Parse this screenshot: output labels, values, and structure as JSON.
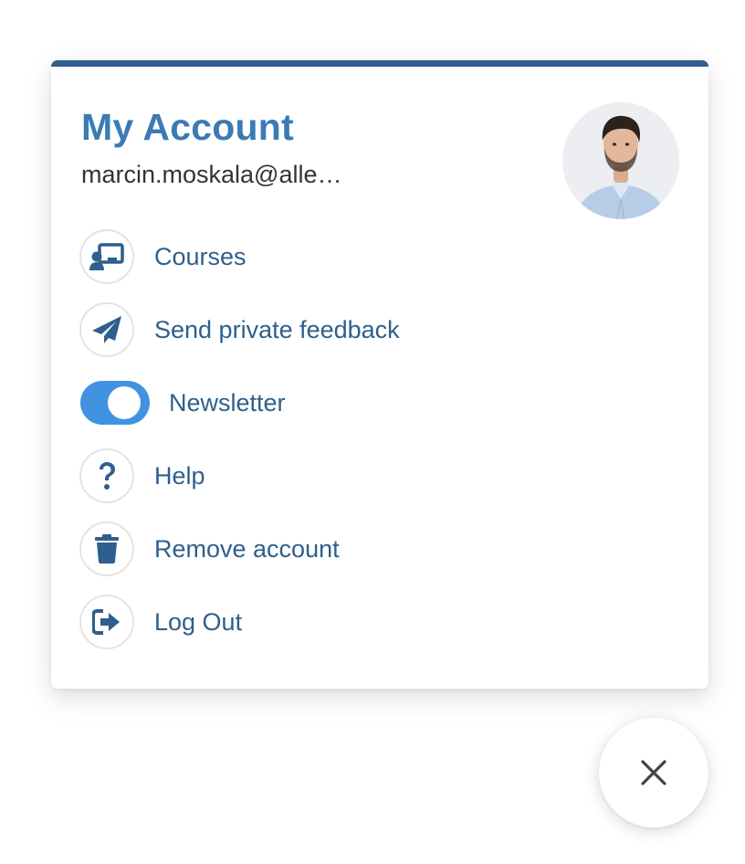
{
  "account_menu": {
    "title": "My Account",
    "email": "marcin.moskala@alle…",
    "accent_color": "#2f5f8c",
    "title_color": "#3b7ab5",
    "items": [
      {
        "label": "Courses",
        "icon": "courses-icon"
      },
      {
        "label": "Send private feedback",
        "icon": "paper-plane-icon"
      },
      {
        "label": "Newsletter",
        "icon": "toggle-switch",
        "toggle_on": true
      },
      {
        "label": "Help",
        "icon": "question-mark-icon"
      },
      {
        "label": "Remove account",
        "icon": "trash-icon"
      },
      {
        "label": "Log Out",
        "icon": "sign-out-icon"
      }
    ]
  },
  "close_button": {
    "icon": "close-icon"
  }
}
